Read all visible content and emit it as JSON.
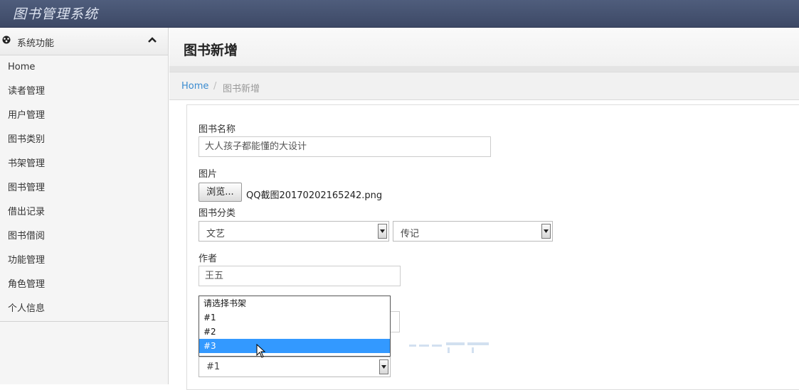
{
  "app": {
    "title": "图书管理系统"
  },
  "sidebar": {
    "header": "系统功能",
    "items": [
      {
        "label": "Home"
      },
      {
        "label": "读者管理"
      },
      {
        "label": "用户管理"
      },
      {
        "label": "图书类别"
      },
      {
        "label": "书架管理"
      },
      {
        "label": "图书管理"
      },
      {
        "label": "借出记录"
      },
      {
        "label": "图书借阅"
      },
      {
        "label": "功能管理"
      },
      {
        "label": "角色管理"
      },
      {
        "label": "个人信息"
      }
    ]
  },
  "page": {
    "title": "图书新增"
  },
  "breadcrumb": {
    "home": "Home",
    "separator": "/",
    "current": "图书新增"
  },
  "form": {
    "name_label": "图书名称",
    "name_value": "大人孩子都能懂的大设计",
    "image_label": "图片",
    "browse_label": "浏览...",
    "file_name": "QQ截图20170202165242.png",
    "category_label": "图书分类",
    "category_main": "文艺",
    "category_sub": "传记",
    "author_label": "作者",
    "author_value": "王五",
    "shelf_selected": "#1",
    "shelf_options": [
      {
        "label": "请选择书架"
      },
      {
        "label": "#1"
      },
      {
        "label": "#2"
      },
      {
        "label": "#3"
      }
    ],
    "shelf_highlighted": "#3"
  },
  "colors": {
    "navbar": "#45526f",
    "link": "#3a8bd0",
    "highlight": "#3399ff"
  }
}
